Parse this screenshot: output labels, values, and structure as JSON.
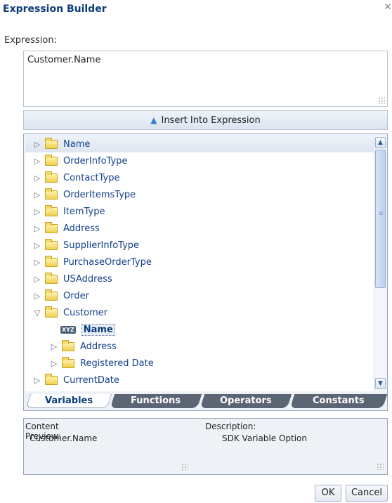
{
  "dialog": {
    "title": "Expression Builder",
    "close_glyph": "✕"
  },
  "expression": {
    "label": "Expression:",
    "value": "Customer.Name"
  },
  "insert_button": {
    "label": "Insert Into Expression",
    "icon": "chevron-up-icon"
  },
  "tree": {
    "items": [
      {
        "label": "Name",
        "icon": "folder-icon",
        "expander": "collapsed",
        "level": 0,
        "selected": true
      },
      {
        "label": "OrderInfoType",
        "icon": "folder-icon",
        "expander": "collapsed",
        "level": 0
      },
      {
        "label": "ContactType",
        "icon": "folder-icon",
        "expander": "collapsed",
        "level": 0
      },
      {
        "label": "OrderItemsType",
        "icon": "folder-icon",
        "expander": "collapsed",
        "level": 0
      },
      {
        "label": "ItemType",
        "icon": "folder-icon",
        "expander": "collapsed",
        "level": 0
      },
      {
        "label": "Address",
        "icon": "folder-icon",
        "expander": "collapsed",
        "level": 0
      },
      {
        "label": "SupplierInfoType",
        "icon": "folder-icon",
        "expander": "collapsed",
        "level": 0
      },
      {
        "label": "PurchaseOrderType",
        "icon": "folder-icon",
        "expander": "collapsed",
        "level": 0
      },
      {
        "label": "USAddress",
        "icon": "folder-icon",
        "expander": "collapsed",
        "level": 0
      },
      {
        "label": "Order",
        "icon": "folder-icon",
        "expander": "collapsed",
        "level": 0
      },
      {
        "label": "Customer",
        "icon": "folder-icon",
        "expander": "expanded",
        "level": 0
      },
      {
        "label": "Name",
        "icon": "xyz-variable-icon",
        "badge": "XYZ",
        "expander": "none",
        "level": 1,
        "focused": true
      },
      {
        "label": "Address",
        "icon": "folder-icon",
        "expander": "collapsed",
        "level": 1
      },
      {
        "label": "Registered Date",
        "icon": "folder-icon",
        "expander": "collapsed",
        "level": 1
      },
      {
        "label": "CurrentDate",
        "icon": "folder-icon",
        "expander": "collapsed",
        "level": 0
      }
    ]
  },
  "tabs": [
    {
      "label": "Variables",
      "active": true
    },
    {
      "label": "Functions",
      "active": false
    },
    {
      "label": "Operators",
      "active": false
    },
    {
      "label": "Constants",
      "active": false
    }
  ],
  "preview": {
    "content_label": "Content Preview:",
    "content_value": "Customer.Name",
    "description_label": "Description:",
    "description_value": "SDK Variable Option"
  },
  "buttons": {
    "ok": "OK",
    "cancel": "Cancel"
  },
  "colors": {
    "title": "#0b3d7a",
    "tree_text": "#13418a",
    "tab_inactive": "#5b6573",
    "panel_border": "#9aa7b8"
  }
}
